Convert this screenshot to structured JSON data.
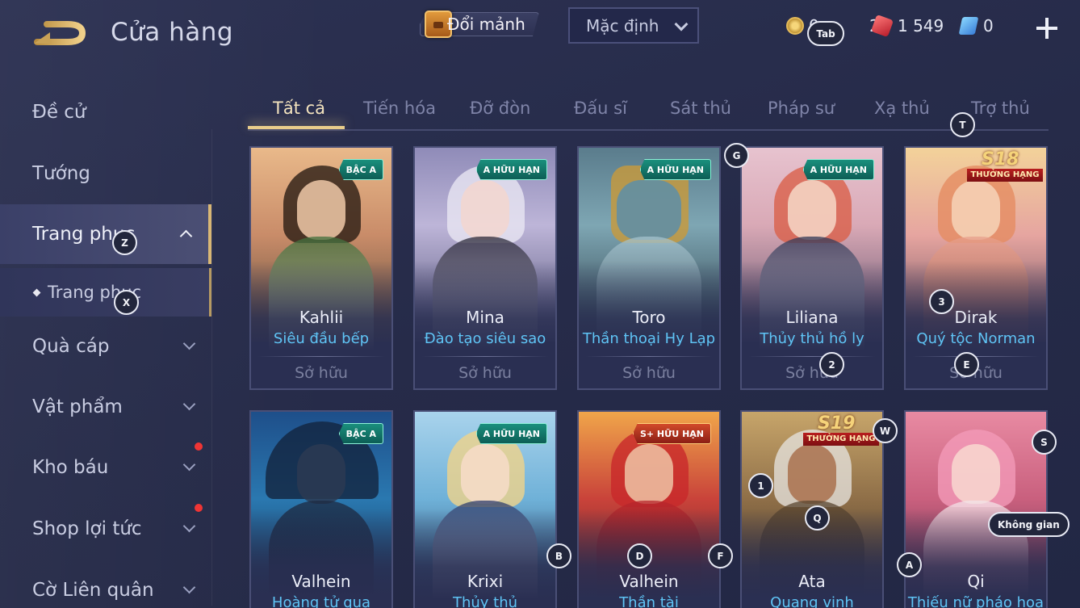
{
  "header": {
    "title": "Cửa hàng",
    "exchange_label": "Đổi mảnh",
    "sort_value": "Mặc định",
    "currency_gold": "0 2",
    "currency_ruby": "1 549",
    "currency_voucher": "0"
  },
  "sidebar": {
    "items": [
      {
        "label": "Đề cử"
      },
      {
        "label": "Tướng"
      },
      {
        "label": "Trang phục"
      },
      {
        "label": "Trang phục"
      },
      {
        "label": "Quà cáp"
      },
      {
        "label": "Vật phẩm"
      },
      {
        "label": "Kho báu"
      },
      {
        "label": "Shop lợi tức"
      },
      {
        "label": "Cờ Liên quân"
      }
    ]
  },
  "tabs": [
    "Tất cả",
    "Tiến hóa",
    "Đỡ đòn",
    "Đấu sĩ",
    "Sát thủ",
    "Pháp sư",
    "Xạ thủ",
    "Trợ thủ"
  ],
  "cards": [
    {
      "hero": "Kahlii",
      "skin": "Siêu đầu bếp",
      "status": "Sở hữu",
      "badge": "BẬC A"
    },
    {
      "hero": "Mina",
      "skin": "Đào tạo siêu sao",
      "status": "Sở hữu",
      "badge": "A HỮU HẠN"
    },
    {
      "hero": "Toro",
      "skin": "Thần thoại Hy Lạp",
      "status": "Sở hữu",
      "badge": "A HỮU HẠN"
    },
    {
      "hero": "Liliana",
      "skin": "Thủy thủ hồ ly",
      "status": "Sở hữu",
      "badge": "A HỮU HẠN"
    },
    {
      "hero": "Dirak",
      "skin": "Quý tộc Norman",
      "status": "Sở hữu",
      "season": "S18",
      "season_label": "THƯỞNG HẠNG"
    },
    {
      "hero": "Valhein",
      "skin": "Hoàng tử quạ",
      "status": "",
      "badge": "BẬC A"
    },
    {
      "hero": "Krixi",
      "skin": "Thủy thủ",
      "status": "",
      "badge": "A HỮU HẠN"
    },
    {
      "hero": "Valhein",
      "skin": "Thần tài",
      "status": "",
      "badge": "S+ HỮU HẠN"
    },
    {
      "hero": "Ata",
      "skin": "Quang vinh",
      "status": "",
      "season": "S19",
      "season_label": "THƯỞNG HẠNG"
    },
    {
      "hero": "Qi",
      "skin": "Thiếu nữ pháo hoa",
      "status": ""
    }
  ],
  "hotkeys": {
    "tab": "Tab",
    "z": "Z",
    "x": "X",
    "t": "T",
    "g": "G",
    "three": "3",
    "two": "2",
    "e": "E",
    "w": "W",
    "s": "S",
    "one": "1",
    "q": "Q",
    "space": "Không gian",
    "b": "B",
    "d": "D",
    "f": "F",
    "a": "A"
  },
  "colors": {
    "accent": "#e9cd8b",
    "skin_name": "#5fc4f5",
    "notify_dot": "#ef3535"
  }
}
